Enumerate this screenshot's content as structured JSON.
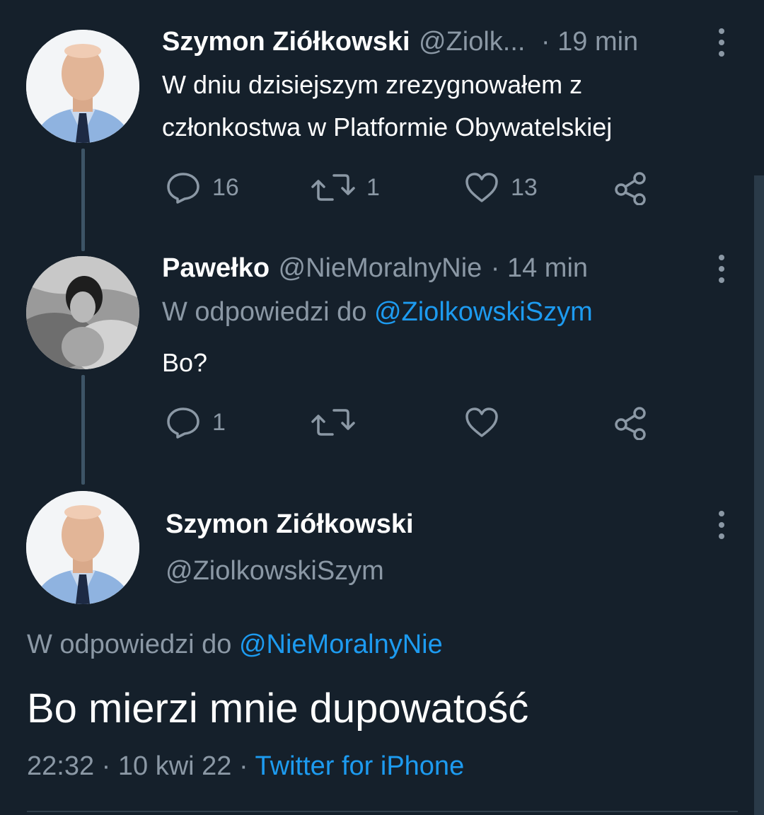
{
  "tweet1": {
    "name": "Szymon Ziółkowski",
    "handle": "@Ziolk...",
    "time": "· 19 min",
    "text_line1": "W dniu dzisiejszym zrezygnowałem z",
    "text_line2": "członkostwa w Platformie Obywatelskiej",
    "replies": "16",
    "retweets": "1",
    "likes": "13"
  },
  "tweet2": {
    "name": "Pawełko",
    "handle": "@NieMoralnyNie",
    "time": "· 14 min",
    "reply_prefix": "W odpowiedzi do",
    "reply_to": "@ZiolkowskiSzym",
    "text": "Bo?",
    "replies": "1"
  },
  "tweet3": {
    "name": "Szymon Ziółkowski",
    "handle": "@ZiolkowskiSzym",
    "reply_prefix": "W odpowiedzi do",
    "reply_to": "@NieMoralnyNie",
    "text": "Bo mierzi mnie dupowatość",
    "time": "22:32",
    "date": "10 kwi 22",
    "separator": "·",
    "client": "Twitter for iPhone"
  },
  "colors": {
    "background": "#15202b",
    "accent": "#1d9bf0",
    "muted": "#8b98a5"
  }
}
